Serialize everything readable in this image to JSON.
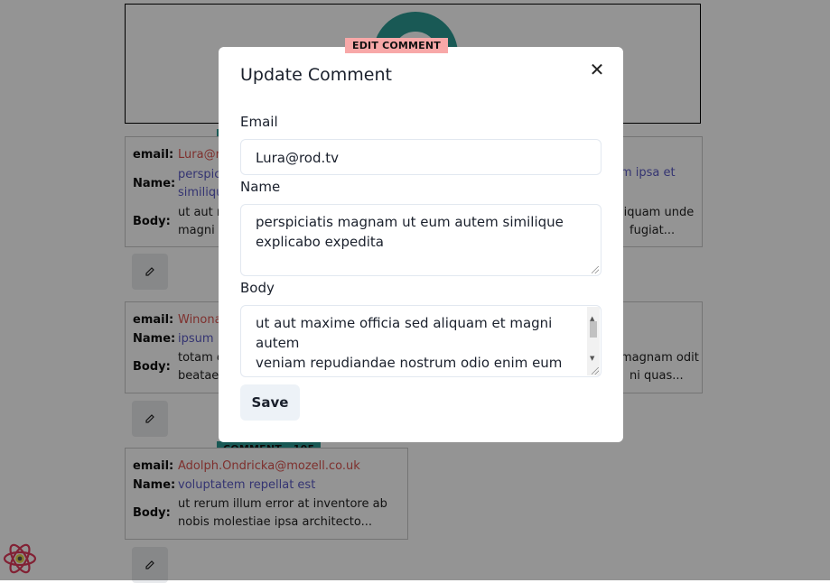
{
  "colors": {
    "accent_teal": "#2c9a93",
    "email_red": "#d9534f",
    "name_purple": "#5b5bc4",
    "edit_badge": "#f8a8a8"
  },
  "cards": [
    {
      "email": "Lura@r",
      "name_lines": [
        "perspici",
        "similiqu"
      ],
      "body_lines": [
        "ut aut m",
        "magni a"
      ],
      "right_name": "m ipsa et",
      "right_body": [
        "liquam unde",
        "fugiat..."
      ]
    },
    {
      "email": "Winona",
      "name": "ipsum",
      "body_lines": [
        "totam e",
        "beatae e"
      ],
      "right_body": [
        "magnam odit",
        "ni quas..."
      ]
    },
    {
      "tag": "COMMENT - 105",
      "email": "Adolph.Ondricka@mozell.co.uk",
      "name": "voluptatem repellat est",
      "body_lines": [
        "ut rerum illum error at inventore ab",
        "nobis molestiae ipsa architecto..."
      ]
    }
  ],
  "labels": {
    "email": "email:",
    "name": "Name:",
    "body": "Body:"
  },
  "modal": {
    "badge": "EDIT COMMENT",
    "title": "Update Comment",
    "close_icon": "close-icon",
    "email_label": "Email",
    "email_value": "Lura@rod.tv",
    "name_label": "Name",
    "name_value_lines": [
      "perspiciatis magnam ut eum autem similique",
      "explicabo expedita"
    ],
    "body_label": "Body",
    "body_value_lines": [
      "ut aut maxime officia sed aliquam et magni",
      "autem",
      "veniam repudiandae nostrum odio enim eum"
    ],
    "save_label": "Save"
  },
  "icons": {
    "edit": "edit-icon",
    "react": "react-logo"
  }
}
